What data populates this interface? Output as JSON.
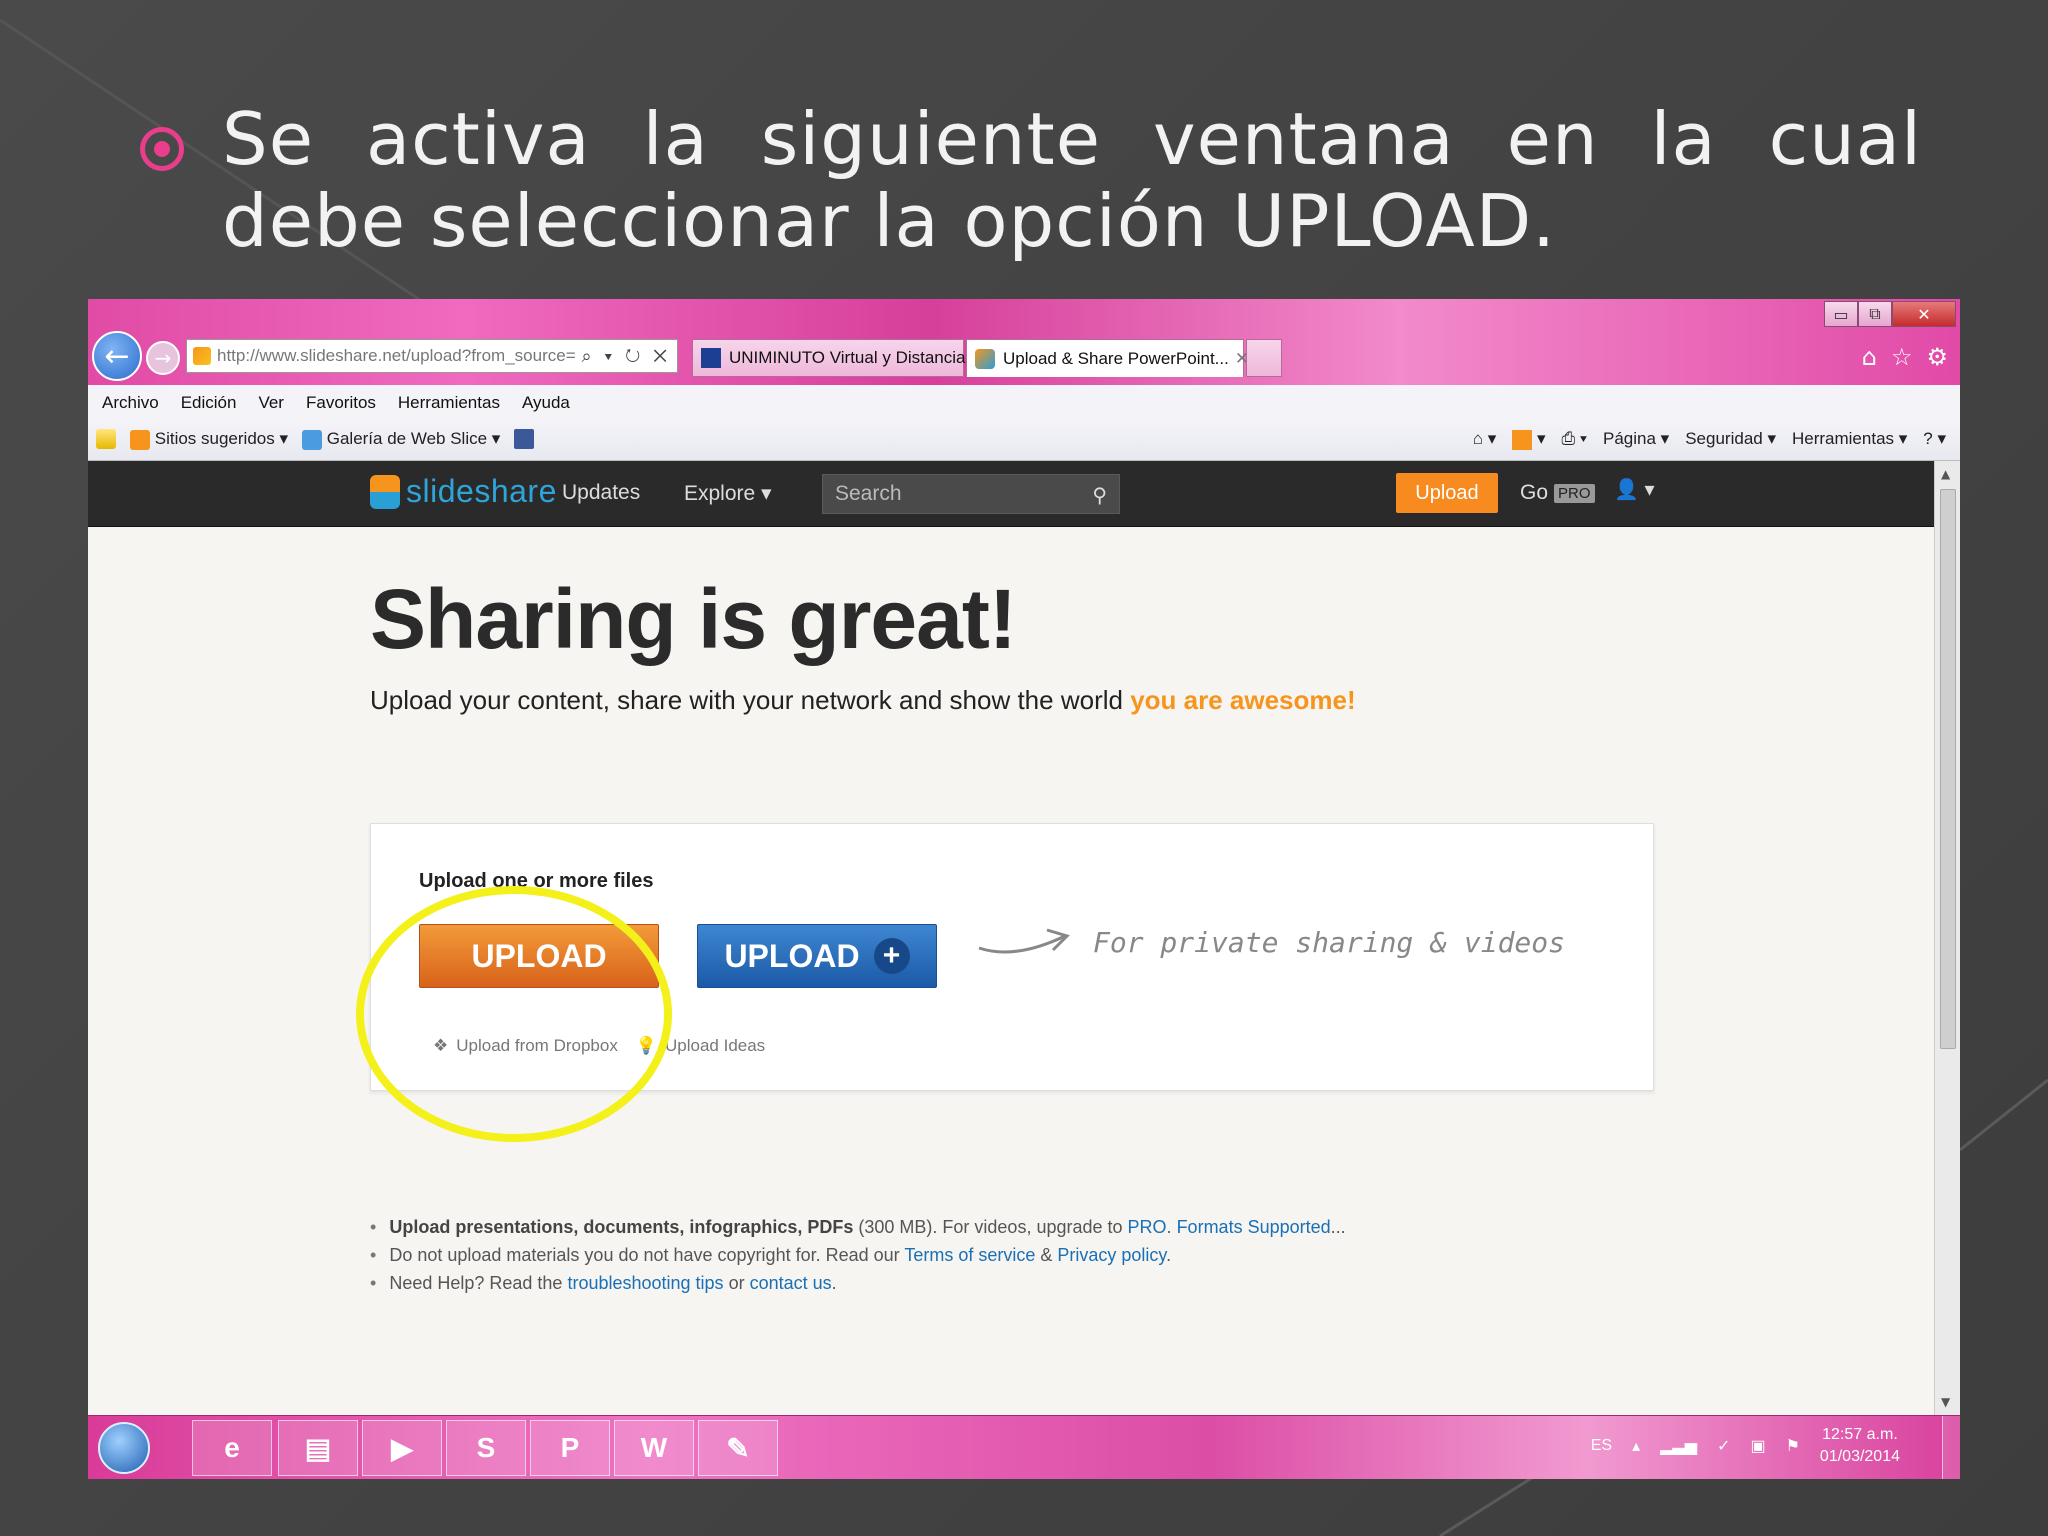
{
  "slide": {
    "title": "Se activa la siguiente ventana en la cual debe seleccionar la opción UPLOAD.",
    "accent_color": "#e83e8c"
  },
  "browser": {
    "address": "http://www.slideshare.net/upload?from_source=lo",
    "address_tools": "⌕ ▾ ↻ ✕",
    "tabs": [
      {
        "label": "UNIMINUTO Virtual y Distancia"
      },
      {
        "label": "Upload & Share PowerPoint...",
        "close": "✕"
      }
    ],
    "window_buttons": {
      "minimize": "▭",
      "restore": "⧉",
      "close": "✕"
    },
    "menu": [
      "Archivo",
      "Edición",
      "Ver",
      "Favoritos",
      "Herramientas",
      "Ayuda"
    ],
    "favorites": {
      "sitios": "Sitios sugeridos ▾",
      "galeria": "Galería de Web Slice ▾",
      "pagina": "Página ▾",
      "seguridad": "Seguridad ▾",
      "herramientas": "Herramientas ▾"
    }
  },
  "slideshare": {
    "logo": "slideshare",
    "nav_updates": "Updates",
    "nav_explore": "Explore ▾",
    "search_placeholder": "Search",
    "upload_btn": "Upload",
    "go": "Go",
    "pro": "PRO",
    "hero_title": "Sharing is great!",
    "hero_sub": "Upload your content, share with your network and show the world ",
    "hero_sub_highlight": "you are awesome!",
    "box_label": "Upload one or more files",
    "upload_primary": "UPLOAD",
    "upload_pro": "UPLOAD",
    "private_note": "For private sharing & videos",
    "dropbox": "Upload from Dropbox",
    "ideas": "Upload Ideas",
    "notes": {
      "n1_bold": "Upload presentations, documents, infographics, PDFs",
      "n1_rest": " (300 MB). For videos, upgrade to ",
      "n1_pro": "PRO",
      "n1_formats": "Formats Supported",
      "n2_start": "Do not upload materials you do not have copyright for. Read our ",
      "n2_terms": "Terms of service",
      "n2_amp": " & ",
      "n2_privacy": "Privacy policy",
      "n3_start": "Need Help? Read the ",
      "n3_tips": "troubleshooting tips",
      "n3_or": " or ",
      "n3_contact": "contact us"
    }
  },
  "taskbar": {
    "apps": [
      "e",
      "▤",
      "▶",
      "S",
      "P",
      "W",
      "✎"
    ],
    "lang": "ES",
    "time": "12:57 a.m.",
    "date": "01/03/2014"
  }
}
